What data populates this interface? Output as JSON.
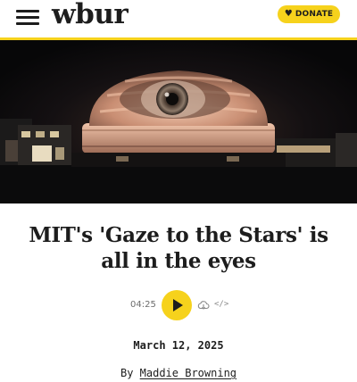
{
  "header": {
    "logo": "wbur",
    "donate_label": "DONATE",
    "accent_color": "#f6d21c"
  },
  "hero": {
    "subject": "Eye projected onto MIT Great Dome at night"
  },
  "article": {
    "headline": "MIT's 'Gaze to the Stars' is all in the eyes",
    "date": "March 12, 2025",
    "byline_prefix": "By",
    "author": "Maddie Browning"
  },
  "audio": {
    "duration": "04:25",
    "embed_glyph": "</>"
  },
  "icons": {
    "menu": "hamburger-icon",
    "donate": "heart-icon",
    "play": "play-icon",
    "download": "cloud-download-icon",
    "embed": "code-icon"
  }
}
